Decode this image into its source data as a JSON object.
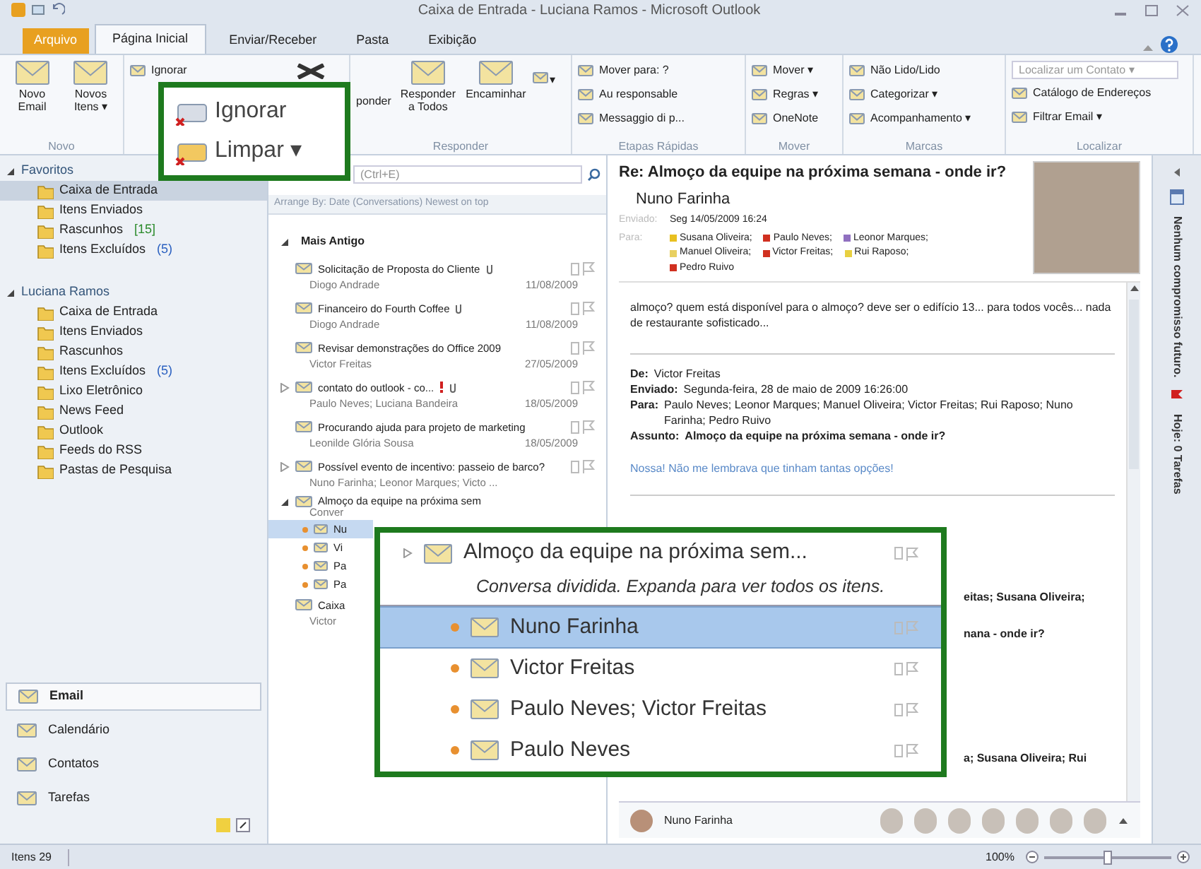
{
  "window": {
    "title": "Caixa de Entrada - Luciana Ramos - Microsoft Outlook"
  },
  "ribbon_tabs": [
    {
      "label": "Arquivo",
      "kind": "file",
      "selected": false
    },
    {
      "label": "Página Inicial",
      "kind": "tab",
      "selected": true
    },
    {
      "label": "Enviar/Receber",
      "kind": "tab",
      "selected": false
    },
    {
      "label": "Pasta",
      "kind": "tab",
      "selected": false
    },
    {
      "label": "Exibição",
      "kind": "tab",
      "selected": false
    }
  ],
  "ribbon_groups": [
    {
      "label": "Novo",
      "items": [
        {
          "kind": "large",
          "label": "Novo Email"
        },
        {
          "kind": "large",
          "label": "Novos Itens ▾"
        }
      ]
    },
    {
      "items": [
        {
          "kind": "small",
          "label": "Ignorar"
        },
        {
          "kind": "delete"
        }
      ]
    },
    {
      "label": "Responder",
      "items": [
        {
          "kind": "partial",
          "label": "ponder"
        },
        {
          "kind": "large",
          "label": "Responder a Todos"
        },
        {
          "kind": "large",
          "label": "Encaminhar"
        },
        {
          "kind": "icon",
          "label": "▾"
        }
      ]
    },
    {
      "label": "Etapas Rápidas",
      "items": [
        {
          "kind": "small",
          "label": "Mover para: ?"
        },
        {
          "kind": "small",
          "label": "Au responsable"
        },
        {
          "kind": "small",
          "label": "Messaggio di p..."
        }
      ]
    },
    {
      "label": "Mover",
      "items": [
        {
          "kind": "small",
          "label": "Mover ▾"
        },
        {
          "kind": "small",
          "label": "Regras ▾"
        },
        {
          "kind": "small",
          "label": "OneNote"
        }
      ]
    },
    {
      "label": "Marcas",
      "items": [
        {
          "kind": "small",
          "label": "Não Lido/Lido"
        },
        {
          "kind": "small",
          "label": "Categorizar ▾"
        },
        {
          "kind": "small",
          "label": "Acompanhamento ▾"
        }
      ]
    },
    {
      "label": "Localizar",
      "items": [
        {
          "kind": "field",
          "label": "Localizar um Contato ▾"
        },
        {
          "kind": "small",
          "label": "Catálogo de Endereços"
        },
        {
          "kind": "small",
          "label": "Filtrar Email ▾"
        }
      ]
    }
  ],
  "callouts": [
    {
      "items": [
        {
          "label": "Ignorar"
        },
        {
          "label": "Limpar ▾"
        }
      ]
    },
    {
      "subject": "Almoço da equipe na próxima sem...",
      "note": "Conversa dividida. Expanda para ver todos os itens.",
      "rows": [
        {
          "sender": "Nuno Farinha",
          "selected": true
        },
        {
          "sender": "Victor Freitas",
          "selected": false
        },
        {
          "sender": "Paulo Neves; Victor Freitas",
          "selected": false
        },
        {
          "sender": "Paulo Neves",
          "selected": false
        }
      ]
    }
  ],
  "folders": [
    {
      "label": "Favoritos",
      "expanded": true,
      "children": [
        {
          "label": "Caixa de Entrada",
          "selected": true
        },
        {
          "label": "Itens Enviados",
          "selected": false
        },
        {
          "label": "Rascunhos",
          "count": "[15]",
          "selected": false
        },
        {
          "label": "Itens Excluídos",
          "count": "(5)",
          "selected": false
        }
      ]
    },
    {
      "label": "Luciana Ramos",
      "expanded": true,
      "children": [
        {
          "label": "Caixa de Entrada",
          "selected": false
        },
        {
          "label": "Itens Enviados",
          "selected": false
        },
        {
          "label": "Rascunhos",
          "selected": false
        },
        {
          "label": "Itens Excluídos",
          "count": "(5)",
          "selected": false
        },
        {
          "label": "Lixo Eletrônico",
          "selected": false
        },
        {
          "label": "News Feed",
          "selected": false
        },
        {
          "label": "Outlook",
          "selected": false
        },
        {
          "label": "Feeds do RSS",
          "selected": false
        },
        {
          "label": "Pastas de Pesquisa",
          "selected": false
        }
      ]
    }
  ],
  "nav_buttons": [
    {
      "label": "Email",
      "selected": true
    },
    {
      "label": "Calendário",
      "selected": false
    },
    {
      "label": "Contatos",
      "selected": false
    },
    {
      "label": "Tarefas",
      "selected": false
    }
  ],
  "message_list": {
    "search": {
      "placeholder": "(Ctrl+E)"
    },
    "arrange": "Arrange By: Date (Conversations) Newest on top",
    "group": "Mais Antigo",
    "items": [
      {
        "kind": "message",
        "subject": "Solicitação de Proposta do Cliente",
        "sender": "Diogo Andrade",
        "date": "11/08/2009",
        "attachment": true,
        "important": false
      },
      {
        "kind": "message",
        "subject": "Financeiro do Fourth Coffee",
        "sender": "Diogo Andrade",
        "date": "11/08/2009",
        "attachment": true,
        "important": false
      },
      {
        "kind": "message",
        "subject": "Revisar demonstrações do Office 2009",
        "sender": "Victor Freitas",
        "date": "27/05/2009",
        "attachment": false,
        "important": false
      },
      {
        "kind": "conversation",
        "expanded": false,
        "subject": "contato do outlook - co...",
        "sender": "Paulo Neves; Luciana Bandeira",
        "date": "18/05/2009",
        "attachment": true,
        "important": true
      },
      {
        "kind": "message",
        "subject": "Procurando ajuda para projeto de marketing",
        "sender": "Leonilde Glória Sousa",
        "date": "18/05/2009",
        "attachment": false,
        "important": false
      },
      {
        "kind": "conversation",
        "expanded": false,
        "subject": "Possível evento de incentivo: passeio de barco?",
        "sender": "Nuno Farinha; Leonor Marques; Victo ...",
        "attachment": false,
        "important": false
      },
      {
        "kind": "conversation",
        "expanded": true,
        "subject": "Almoço da equipe na próxima sem",
        "sender": "Conver",
        "attachment": false,
        "important": false,
        "children": [
          {
            "sender": "Nu",
            "selected": true
          },
          {
            "sender": "Vi",
            "selected": false
          },
          {
            "sender": "Pa",
            "selected": false
          },
          {
            "sender": "Pa",
            "selected": false
          }
        ]
      },
      {
        "kind": "message",
        "subject": "Caixa",
        "sender": "Victor",
        "attachment": false,
        "important": false
      }
    ]
  },
  "reading_pane": {
    "subject": "Re: Almoço da equipe na próxima semana - onde ir?",
    "sender": "Nuno Farinha",
    "sent_label": "Enviado:",
    "sent": "Seg 14/05/2009 16:24",
    "to_label": "Para:",
    "recipients": [
      {
        "name": "Susana Oliveira;",
        "color": "#e8c020"
      },
      {
        "name": "Paulo Neves;",
        "color": "#d03020"
      },
      {
        "name": "Leonor Marques;",
        "color": "#9070c0"
      },
      {
        "name": "Manuel Oliveira;",
        "color": "#e8d060"
      },
      {
        "name": "Victor Freitas;",
        "color": "#d03020"
      },
      {
        "name": "Rui Raposo;",
        "color": "#e8d040"
      },
      {
        "name": "Pedro Ruivo",
        "color": "#d03020"
      }
    ],
    "body": "almoço? quem está disponível para o almoço? deve ser o edifício 13... para todos vocês... nada de restaurante sofisticado...",
    "quoted_header": [
      {
        "label": "De:",
        "value": "Victor Freitas"
      },
      {
        "label": "Enviado:",
        "value": "Segunda-feira, 28 de maio de 2009 16:26:00"
      },
      {
        "label": "Para:",
        "value": "Paulo Neves; Leonor Marques; Manuel Oliveira; Victor Freitas; Rui Raposo; Nuno Farinha; Pedro Ruivo"
      },
      {
        "label": "Assunto:",
        "value": "Almoço da equipe na próxima semana - onde ir?",
        "bold": true
      }
    ],
    "quoted_body": "Nossa! Não me lembrava que tinham tantas opções!",
    "fragments": [
      "eitas; Susana Oliveira;",
      "nana - onde ir?",
      "a; Susana Oliveira; Rui"
    ],
    "people_pane": {
      "name": "Nuno Farinha"
    }
  },
  "todo_bar": {
    "appointments": "Nenhum compromisso futuro.",
    "tasks": "Hoje: 0 Tarefas"
  },
  "status_bar": {
    "items": "Itens 29",
    "zoom": "100%",
    "level": 0.5
  }
}
